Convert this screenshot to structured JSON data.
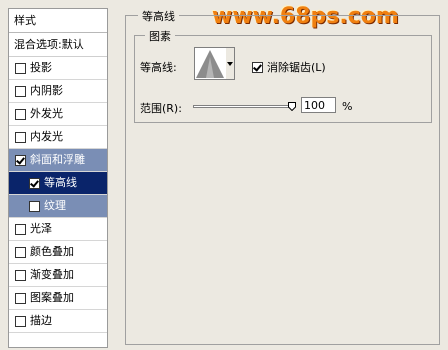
{
  "watermark": "www.68ps.com",
  "sidebar": {
    "header": "样式",
    "blend_options": "混合选项:默认",
    "items": [
      {
        "label": "投影",
        "checked": false,
        "sub": false,
        "state": "normal"
      },
      {
        "label": "内阴影",
        "checked": false,
        "sub": false,
        "state": "normal"
      },
      {
        "label": "外发光",
        "checked": false,
        "sub": false,
        "state": "normal"
      },
      {
        "label": "内发光",
        "checked": false,
        "sub": false,
        "state": "normal"
      },
      {
        "label": "斜面和浮雕",
        "checked": true,
        "sub": false,
        "state": "highlight"
      },
      {
        "label": "等高线",
        "checked": true,
        "sub": true,
        "state": "active"
      },
      {
        "label": "纹理",
        "checked": false,
        "sub": true,
        "state": "highlight"
      },
      {
        "label": "光泽",
        "checked": false,
        "sub": false,
        "state": "normal"
      },
      {
        "label": "颜色叠加",
        "checked": false,
        "sub": false,
        "state": "normal"
      },
      {
        "label": "渐变叠加",
        "checked": false,
        "sub": false,
        "state": "normal"
      },
      {
        "label": "图案叠加",
        "checked": false,
        "sub": false,
        "state": "normal"
      },
      {
        "label": "描边",
        "checked": false,
        "sub": false,
        "state": "normal"
      }
    ]
  },
  "panel": {
    "title": "等高线",
    "elements_group": {
      "legend": "图素",
      "contour_label": "等高线:",
      "contour_preview_icon": "cone-contour-icon",
      "antialias_label": "消除锯齿(L)",
      "antialias_checked": true,
      "range_label": "范围(R):",
      "range_value": "100",
      "range_unit": "%",
      "range_fraction": 1.0
    }
  },
  "colors": {
    "list_highlight": "#7a8eb5",
    "list_active": "#0a246a",
    "watermark": "#f08010"
  }
}
